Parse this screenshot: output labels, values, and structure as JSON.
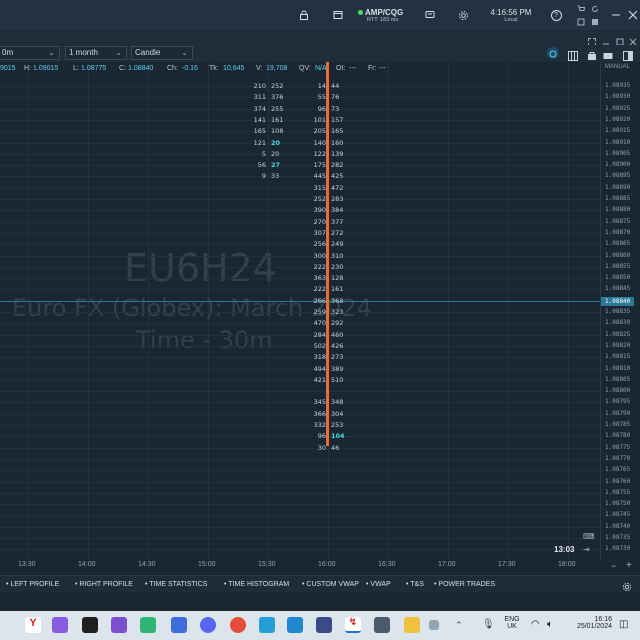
{
  "header": {
    "connection": "AMP/CQG",
    "rtt": "RTT: 183 ms",
    "clock_time": "4:16:56 PM",
    "clock_zone": "Local",
    "help": "?"
  },
  "toolbar": {
    "interval": "0m",
    "range": "1 month",
    "chart_type": "Candle"
  },
  "info": {
    "open": "9015",
    "high_label": "H:",
    "high": "1.09015",
    "low_label": "L:",
    "low": "1.08775",
    "close_label": "C:",
    "close": "1.08840",
    "change_label": "Ch:",
    "change": "-0.16",
    "tick_label": "Tk:",
    "tick": "10,645",
    "vol_label": "V:",
    "vol": "19,708",
    "qv_label": "QV:",
    "qv": "N/A",
    "oi_label": "OI:",
    "oi": "---",
    "fr_label": "Fr:",
    "fr": "---"
  },
  "watermark": {
    "symbol": "EU6H24",
    "description": "Euro FX (Globex): March 2024",
    "timeframe": "Time - 30m"
  },
  "price_axis": {
    "mode": "MANUAL",
    "labels": [
      "1.08935",
      "1.08930",
      "1.08925",
      "1.08920",
      "1.08915",
      "1.08910",
      "1.08905",
      "1.08900",
      "1.08895",
      "1.08890",
      "1.08885",
      "1.08880",
      "1.08875",
      "1.08870",
      "1.08865",
      "1.08860",
      "1.08855",
      "1.08850",
      "1.08845",
      "1.08840",
      "1.08835",
      "1.08830",
      "1.08825",
      "1.08820",
      "1.08815",
      "1.08810",
      "1.08805",
      "1.08800",
      "1.08795",
      "1.08790",
      "1.08785",
      "1.08780",
      "1.08775",
      "1.08770",
      "1.08765",
      "1.08760",
      "1.08755",
      "1.08750",
      "1.08745",
      "1.08740",
      "1.08735",
      "1.08730"
    ],
    "current_price": "1.08840",
    "countdown": "13:03"
  },
  "time_axis": {
    "labels": [
      "13:30",
      "14:00",
      "14:30",
      "15:00",
      "15:30",
      "16:00",
      "16:30",
      "17:00",
      "17:30",
      "18:00"
    ]
  },
  "footprint": {
    "left_column": [
      [
        "210",
        "252"
      ],
      [
        "311",
        "376"
      ],
      [
        "374",
        "255"
      ],
      [
        "141",
        "161"
      ],
      [
        "165",
        "108"
      ],
      [
        "121",
        "20"
      ],
      [
        "5",
        "20"
      ],
      [
        "56",
        "27"
      ],
      [
        "9",
        "33"
      ]
    ],
    "right_column": [
      [
        "14",
        "44"
      ],
      [
        "55",
        "76"
      ],
      [
        "96",
        "73"
      ],
      [
        "101",
        "157"
      ],
      [
        "205",
        "165"
      ],
      [
        "140",
        "160"
      ],
      [
        "122",
        "139"
      ],
      [
        "175",
        "282"
      ],
      [
        "445",
        "425"
      ],
      [
        "315",
        "472"
      ],
      [
        "252",
        "283"
      ],
      [
        "390",
        "384"
      ],
      [
        "270",
        "377"
      ],
      [
        "307",
        "272"
      ],
      [
        "256",
        "249"
      ],
      [
        "300",
        "310"
      ],
      [
        "222",
        "230"
      ],
      [
        "363",
        "128"
      ],
      [
        "222",
        "161"
      ],
      [
        "266",
        "368"
      ],
      [
        "259",
        "323"
      ],
      [
        "470",
        "292"
      ],
      [
        "284",
        "460"
      ],
      [
        "502",
        "426"
      ],
      [
        "318",
        "273"
      ],
      [
        "494",
        "389"
      ],
      [
        "421",
        "510"
      ],
      [
        "",
        ""
      ],
      [
        "345",
        "348"
      ],
      [
        "366",
        "304"
      ],
      [
        "332",
        "253"
      ],
      [
        "96",
        "104"
      ],
      [
        "30",
        "46"
      ]
    ]
  },
  "bottom_tabs": [
    "LEFT PROFILE",
    "RIGHT PROFILE",
    "TIME STATISTICS",
    "TIME HISTOGRAM",
    "CUSTOM VWAP",
    "VWAP",
    "T&S",
    "POWER TRADES"
  ],
  "taskbar": {
    "lang1": "ENG",
    "lang2": "UK",
    "time": "16:16",
    "date": "25/01/2024"
  },
  "colors": {
    "background": "#1a2631",
    "current_price_line": "#2a7a96",
    "current_candle": "#e8702c",
    "highlight": "#3fe0e0"
  }
}
